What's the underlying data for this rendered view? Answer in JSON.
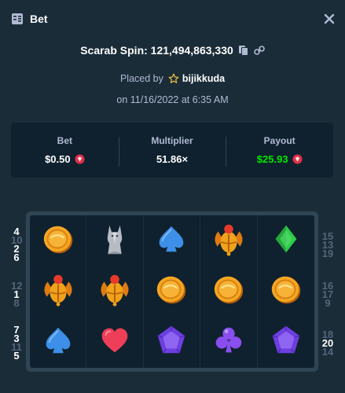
{
  "header": {
    "title": "Bet",
    "icon": "bet-slip-icon",
    "close_icon": "close-icon"
  },
  "spin": {
    "label": "Scarab Spin: 121,494,863,330",
    "copy_icon": "copy-icon",
    "link_icon": "link-icon"
  },
  "placed": {
    "prefix": "Placed by",
    "user": "bijikkuda",
    "icon": "star-icon"
  },
  "date": "on 11/16/2022 at 6:35 AM",
  "stats": {
    "bet": {
      "label": "Bet",
      "value": "$0.50"
    },
    "multiplier": {
      "label": "Multiplier",
      "value": "51.86×"
    },
    "payout": {
      "label": "Payout",
      "value": "$25.93"
    },
    "currency_icon": "gem-icon",
    "payout_color": "#00e701"
  },
  "grid": [
    [
      "coin",
      "cat",
      "spade",
      "scarab",
      "diamond"
    ],
    [
      "scarab",
      "scarab",
      "coin",
      "coin",
      "coin"
    ],
    [
      "spade",
      "heart",
      "gem",
      "club",
      "gem"
    ]
  ],
  "paylines": {
    "left": [
      [
        {
          "n": "4",
          "bright": true
        },
        {
          "n": "10",
          "bright": false
        },
        {
          "n": "2",
          "bright": true
        },
        {
          "n": "6",
          "bright": true
        }
      ],
      [
        {
          "n": "12",
          "bright": false
        },
        {
          "n": "1",
          "bright": true
        },
        {
          "n": "8",
          "bright": false
        }
      ],
      [
        {
          "n": "7",
          "bright": true
        },
        {
          "n": "3",
          "bright": true
        },
        {
          "n": "11",
          "bright": false
        },
        {
          "n": "5",
          "bright": true
        }
      ]
    ],
    "right": [
      [
        {
          "n": "15",
          "bright": false
        },
        {
          "n": "13",
          "bright": false
        },
        {
          "n": "19",
          "bright": false
        }
      ],
      [
        {
          "n": "16",
          "bright": false
        },
        {
          "n": "17",
          "bright": false
        },
        {
          "n": "9",
          "bright": false
        }
      ],
      [
        {
          "n": "18",
          "bright": false
        },
        {
          "n": "20",
          "bright": true
        },
        {
          "n": "14",
          "bright": false
        }
      ]
    ]
  },
  "colors": {
    "background": "#1a2c38",
    "panel": "#0f212e",
    "border": "#2f4553",
    "muted": "#b1bad3"
  }
}
